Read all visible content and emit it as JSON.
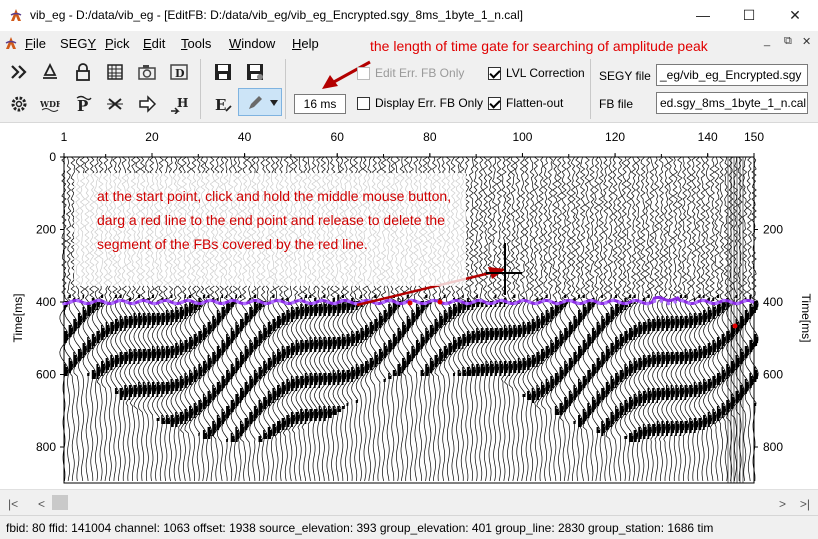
{
  "window": {
    "title": "vib_eg - D:/data/vib_eg - [EditFB: D:/data/vib_eg/vib_eg_Encrypted.sgy_8ms_1byte_1_n.cal]",
    "minimize": "—",
    "maximize": "☐",
    "close": "✕"
  },
  "menu": {
    "items": [
      {
        "pre": "",
        "ul": "F",
        "post": "ile"
      },
      {
        "pre": "SEG",
        "ul": "Y",
        "post": ""
      },
      {
        "pre": "",
        "ul": "P",
        "post": "ick"
      },
      {
        "pre": "",
        "ul": "E",
        "post": "dit"
      },
      {
        "pre": "",
        "ul": "T",
        "post": "ools"
      },
      {
        "pre": "",
        "ul": "W",
        "post": "indow"
      },
      {
        "pre": "",
        "ul": "H",
        "post": "elp"
      }
    ],
    "mdi_minimize": "_",
    "mdi_restore": "⧉",
    "mdi_close": "✕"
  },
  "annotations": {
    "top": "the length of time gate for searching of amplitude peak",
    "callout": "at the start point, click and hold the middle mouse button, darg a red line to the end point and release to delete the segment of the FBs covered by the red line."
  },
  "toolbar": {
    "time_gate_value": "16 ms",
    "edit_err_fb_only": "Edit Err. FB Only",
    "display_err_fb_only": "Display Err. FB Only",
    "lvl_correction": "LVL Correction",
    "flatten_out": "Flatten-out",
    "segy_file_label": "SEGY file",
    "segy_file_value": "_eg/vib_eg_Encrypted.sgy",
    "fb_file_label": "FB file",
    "fb_file_value": "ed.sgy_8ms_1byte_1_n.cal"
  },
  "plot": {
    "x_ticks": [
      "1",
      "20",
      "40",
      "60",
      "80",
      "100",
      "120",
      "140",
      "150"
    ],
    "y_ticks": [
      "0",
      "200",
      "400",
      "600",
      "800"
    ],
    "y_ticks_right": [
      "200",
      "400",
      "600",
      "800"
    ],
    "y_label_left": "Time[ms]",
    "y_label_right": "Time[ms]"
  },
  "scroll": {
    "left": "|<",
    "left2": "<",
    "right2": ">",
    "right": ">|"
  },
  "status": "fbid: 80  ffid: 141004  channel: 1063  offset: 1938  source_elevation: 393  group_elevation: 401  group_line: 2830  group_station: 1686  tim"
}
